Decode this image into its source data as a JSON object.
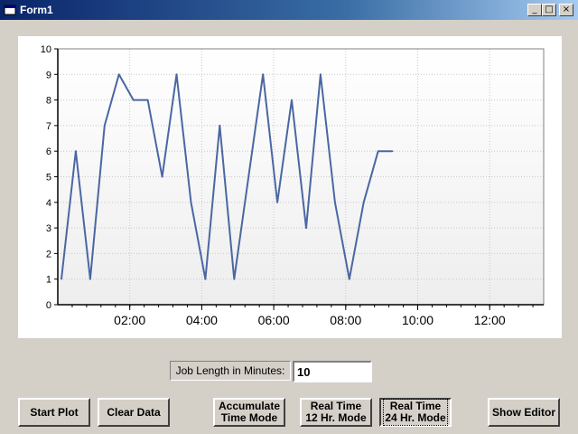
{
  "window": {
    "title": "Form1",
    "minimize_glyph": "_",
    "maximize_glyph": "□",
    "close_glyph": "×"
  },
  "chart_data": {
    "type": "line",
    "title": "",
    "xlabel": "",
    "ylabel": "",
    "x_unit": "hours",
    "x": [
      0.1,
      0.5,
      0.9,
      1.3,
      1.7,
      2.1,
      2.5,
      2.9,
      3.3,
      3.7,
      4.1,
      4.5,
      4.9,
      5.3,
      5.7,
      6.1,
      6.5,
      6.9,
      7.3,
      7.7,
      8.1,
      8.5,
      8.9,
      9.3
    ],
    "values": [
      1,
      6,
      1,
      7,
      9,
      8,
      8,
      5,
      9,
      4,
      1,
      7,
      1,
      5,
      9,
      4,
      8,
      3,
      9,
      4,
      1,
      4,
      6,
      6
    ],
    "xlim": [
      0,
      13.5
    ],
    "ylim": [
      0,
      10
    ],
    "y_ticks": [
      0,
      1,
      2,
      3,
      4,
      5,
      6,
      7,
      8,
      9,
      10
    ],
    "x_ticks": [
      {
        "value": 2,
        "label": "02:00"
      },
      {
        "value": 4,
        "label": "04:00"
      },
      {
        "value": 6,
        "label": "06:00"
      },
      {
        "value": 8,
        "label": "08:00"
      },
      {
        "value": 10,
        "label": "10:00"
      },
      {
        "value": 12,
        "label": "12:00"
      }
    ],
    "grid": true,
    "line_color": "#4a67a2",
    "background_top": "#ffffff",
    "background_bottom": "#eeeeee"
  },
  "job_length": {
    "label": "Job Length in Minutes:",
    "value": "10"
  },
  "buttons": {
    "start_plot": "Start Plot",
    "clear_data": "Clear Data",
    "accumulate": "Accumulate\nTime Mode",
    "realtime12": "Real Time\n12 Hr. Mode",
    "realtime24": "Real Time\n24 Hr. Mode",
    "show_editor": "Show Editor"
  }
}
